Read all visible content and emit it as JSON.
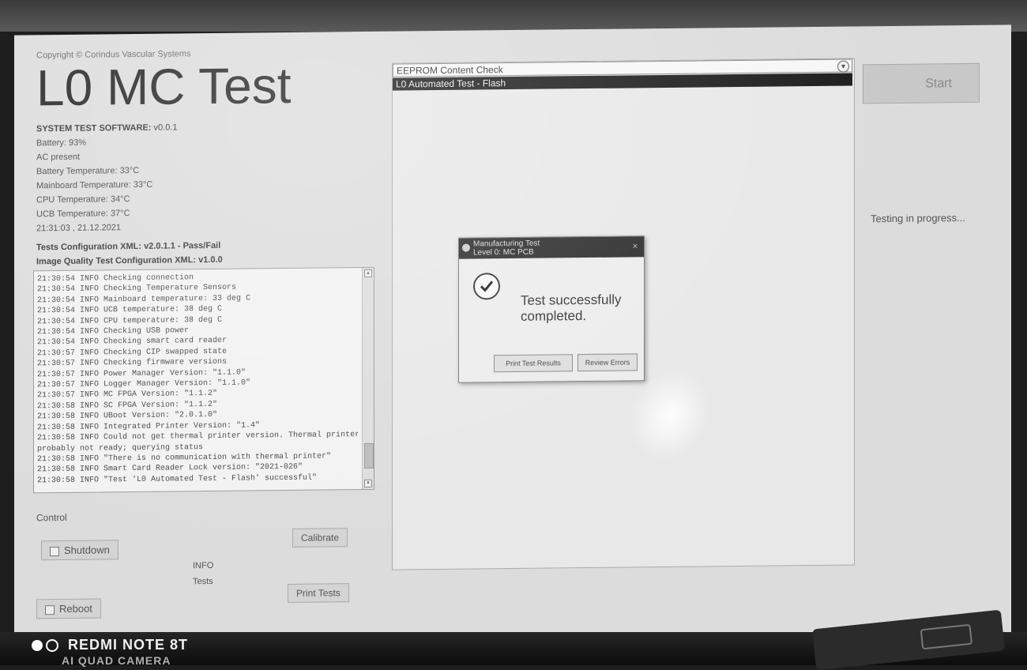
{
  "app": {
    "copyright": "Copyright © Corindus Vascular Systems",
    "title": "L0 MC Test"
  },
  "system_info": {
    "software_label": "SYSTEM TEST SOFTWARE:",
    "software_version": "v0.0.1",
    "battery": "Battery: 93%",
    "ac": "AC present",
    "battery_temp": "Battery Temperature: 33°C",
    "mainboard_temp": "Mainboard Temperature: 33°C",
    "cpu_temp": "CPU Temperature: 34°C",
    "ucb_temp": "UCB Temperature: 37°C",
    "timestamp": "21:31:03 , 21.12.2021",
    "tests_config": "Tests Configuration XML: v2.0.1.1 - Pass/Fail",
    "image_quality_config": "Image Quality Test Configuration XML: v1.0.0"
  },
  "log": [
    "21:30:54 INFO   Checking connection",
    "21:30:54 INFO   Checking Temperature Sensors",
    "21:30:54 INFO   Mainboard temperature: 33 deg C",
    "21:30:54 INFO   UCB temperature: 38 deg C",
    "21:30:54 INFO   CPU temperature: 38 deg C",
    "21:30:54 INFO   Checking USB power",
    "21:30:54 INFO   Checking smart card reader",
    "21:30:57 INFO   Checking CIP swapped state",
    "21:30:57 INFO   Checking firmware versions",
    "21:30:57 INFO   Power Manager Version: \"1.1.0\"",
    "21:30:57 INFO   Logger Manager Version: \"1.1.0\"",
    "21:30:57 INFO   MC FPGA Version: \"1.1.2\"",
    "21:30:58 INFO   SC FPGA Version: \"1.1.2\"",
    "21:30:58 INFO   UBoot Version: \"2.0.1.0\"",
    "21:30:58 INFO   Integrated Printer Version: \"1.4\"",
    "21:30:58 INFO   Could not get thermal printer version. Thermal printer",
    "probably not ready; querying status",
    "21:30:58 INFO   \"There is no communication with thermal printer\"",
    "21:30:58 INFO   Smart Card Reader Lock version: \"2021-026\"",
    "21:30:58 INFO   \"Test 'L0 Automated Test - Flash' successful\""
  ],
  "control": {
    "label": "Control",
    "shutdown": "Shutdown",
    "reboot": "Reboot",
    "calibrate": "Calibrate",
    "print_tests": "Print Tests",
    "info_label": "INFO",
    "tests_label": "Tests"
  },
  "test_selector": {
    "selected_option": "EEPROM Content Check",
    "active_test": "L0 Automated Test - Flash"
  },
  "dialog": {
    "title_line1": "Manufacturing Test",
    "title_line2": "Level 0: MC PCB",
    "close_glyph": "×",
    "message": "Test successfully completed.",
    "print_button": "Print Test Results",
    "history_button": "Review Errors"
  },
  "right_panel": {
    "start_button": "Start",
    "status": "Testing in progress..."
  },
  "watermark": {
    "device": "REDMI NOTE 8T",
    "camera": "AI QUAD CAMERA"
  }
}
